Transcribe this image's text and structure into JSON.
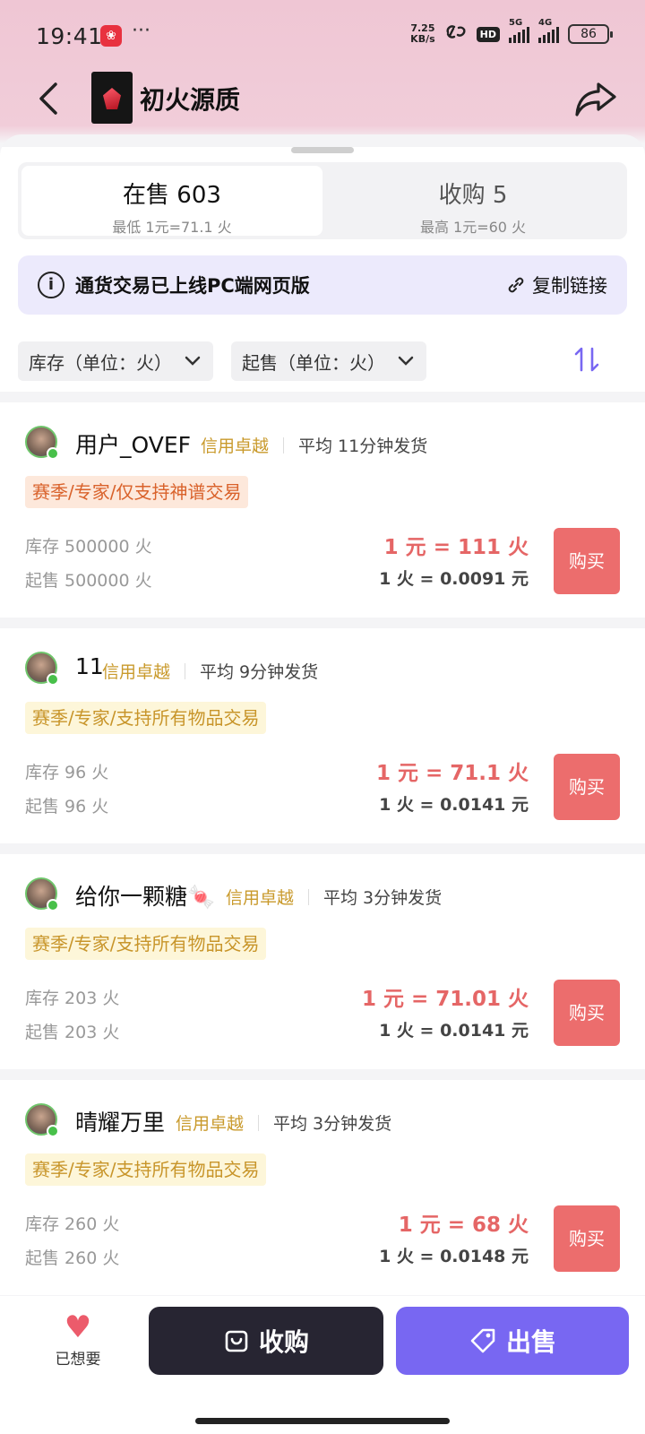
{
  "status": {
    "time": "19:41",
    "dots": "···",
    "net_speed_value": "7.25",
    "net_speed_unit": "KB/s",
    "hd": "HD",
    "signal1": "5G",
    "signal2": "4G",
    "battery": "86"
  },
  "header": {
    "title": "初火源质"
  },
  "tabs": [
    {
      "title": "在售 603",
      "sub": "最低 1元=71.1 火"
    },
    {
      "title": "收购 5",
      "sub": "最高 1元=60 火"
    }
  ],
  "notice": {
    "text": "通货交易已上线PC端网页版",
    "link": "复制链接"
  },
  "filters": [
    {
      "label": "库存（单位：火）"
    },
    {
      "label": "起售（单位：火）"
    }
  ],
  "listings": [
    {
      "name": "用户_OVEF",
      "credit": "信用卓越",
      "avg": "平均 11分钟发货",
      "tag": "赛季/专家/仅支持神谱交易",
      "tag_style": "orange",
      "stock": "库存 500000 火",
      "min": "起售 500000 火",
      "price_main": "1 元 = 111 火",
      "price_sub": "1 火 = 0.0091 元",
      "buy": "购买"
    },
    {
      "name": "11",
      "credit": "信用卓越",
      "avg": "平均 9分钟发货",
      "tag": "赛季/专家/支持所有物品交易",
      "tag_style": "yellow",
      "stock": "库存 96 火",
      "min": "起售 96 火",
      "price_main": "1 元 = 71.1 火",
      "price_sub": "1 火 = 0.0141 元",
      "buy": "购买"
    },
    {
      "name": "给你一颗糖🍬",
      "credit": "信用卓越",
      "avg": "平均 3分钟发货",
      "tag": "赛季/专家/支持所有物品交易",
      "tag_style": "yellow",
      "stock": "库存 203 火",
      "min": "起售 203 火",
      "price_main": "1 元 = 71.01 火",
      "price_sub": "1 火 = 0.0141 元",
      "buy": "购买"
    },
    {
      "name": "晴耀万里",
      "credit": "信用卓越",
      "avg": "平均 3分钟发货",
      "tag": "赛季/专家/支持所有物品交易",
      "tag_style": "yellow",
      "stock": "库存 260 火",
      "min": "起售 260 火",
      "price_main": "1 元 = 68 火",
      "price_sub": "1 火 = 0.0148 元",
      "buy": "购买"
    }
  ],
  "bottom": {
    "wish": "已想要",
    "buy_order": "收购",
    "sell": "出售"
  },
  "colors": {
    "accent": "#7867f2",
    "buy_button": "#ec6d6d",
    "price": "#e56666",
    "credit": "#c99a2c"
  }
}
